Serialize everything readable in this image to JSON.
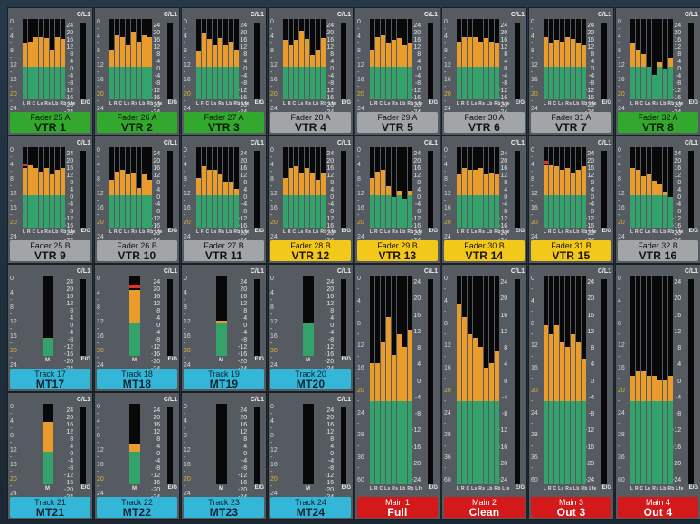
{
  "colors": {
    "green": "#33a82e",
    "gray": "#a1a5a8",
    "yellow": "#f2c81a",
    "cyan": "#33b6d8",
    "red": "#d4191b",
    "meter_green": "#34a36b",
    "meter_orange": "#e99b2c",
    "peak": "#e3312c"
  },
  "strips": [
    {
      "line1": "Fader 25 A",
      "line2": "VTR 1",
      "color": "green",
      "type": "multi",
      "levels": [
        0.7,
        0.72,
        0.78,
        0.78,
        0.76,
        0.62,
        0.78,
        0.75
      ]
    },
    {
      "line1": "Fader 26 A",
      "line2": "VTR 2",
      "color": "green",
      "type": "multi",
      "levels": [
        0.62,
        0.8,
        0.78,
        0.68,
        0.84,
        0.72,
        0.8,
        0.78
      ]
    },
    {
      "line1": "Fader 27 A",
      "line2": "VTR 3",
      "color": "green",
      "type": "multi",
      "levels": [
        0.6,
        0.82,
        0.75,
        0.68,
        0.76,
        0.68,
        0.72,
        0.62
      ]
    },
    {
      "line1": "Fader 28 A",
      "line2": "VTR 4",
      "color": "gray",
      "type": "multi",
      "levels": [
        0.74,
        0.68,
        0.74,
        0.85,
        0.75,
        0.55,
        0.62,
        0.76
      ]
    },
    {
      "line1": "Fader 29 A",
      "line2": "VTR 5",
      "color": "gray",
      "type": "multi",
      "levels": [
        0.62,
        0.78,
        0.8,
        0.7,
        0.74,
        0.76,
        0.68,
        0.7
      ]
    },
    {
      "line1": "Fader 30 A",
      "line2": "VTR 6",
      "color": "gray",
      "type": "multi",
      "levels": [
        0.72,
        0.78,
        0.78,
        0.78,
        0.72,
        0.76,
        0.72,
        0.7
      ]
    },
    {
      "line1": "Fader 31 A",
      "line2": "VTR 7",
      "color": "gray",
      "type": "multi",
      "levels": [
        0.78,
        0.7,
        0.74,
        0.72,
        0.78,
        0.75,
        0.7,
        0.68
      ]
    },
    {
      "line1": "Fader 32 A",
      "line2": "VTR 8",
      "color": "green",
      "type": "multi",
      "levels": [
        0.7,
        0.62,
        0.56,
        0.4,
        0.3,
        0.46,
        0.38,
        0.52
      ]
    },
    {
      "line1": "Fader 25 B",
      "line2": "VTR 9",
      "color": "gray",
      "type": "multi",
      "levels": [
        0.74,
        0.78,
        0.74,
        0.7,
        0.74,
        0.66,
        0.72,
        0.74
      ],
      "peak": 1
    },
    {
      "line1": "Fader 26 B",
      "line2": "VTR 10",
      "color": "gray",
      "type": "multi",
      "levels": [
        0.6,
        0.7,
        0.72,
        0.66,
        0.68,
        0.5,
        0.66,
        0.6
      ]
    },
    {
      "line1": "Fader 27 B",
      "line2": "VTR 11",
      "color": "gray",
      "type": "multi",
      "levels": [
        0.62,
        0.76,
        0.72,
        0.72,
        0.66,
        0.56,
        0.56,
        0.48
      ]
    },
    {
      "line1": "Fader 28 B",
      "line2": "VTR 12",
      "color": "yellow",
      "type": "multi",
      "levels": [
        0.62,
        0.74,
        0.76,
        0.68,
        0.74,
        0.68,
        0.6,
        0.68
      ]
    },
    {
      "line1": "Fader 29 B",
      "line2": "VTR 13",
      "color": "yellow",
      "type": "multi",
      "levels": [
        0.62,
        0.7,
        0.72,
        0.52,
        0.38,
        0.46,
        0.36,
        0.46
      ]
    },
    {
      "line1": "Fader 30 B",
      "line2": "VTR 14",
      "color": "yellow",
      "type": "multi",
      "levels": [
        0.66,
        0.74,
        0.72,
        0.72,
        0.74,
        0.66,
        0.68,
        0.66
      ]
    },
    {
      "line1": "Fader 31 B",
      "line2": "VTR 15",
      "color": "yellow",
      "type": "multi",
      "levels": [
        0.78,
        0.78,
        0.76,
        0.72,
        0.74,
        0.68,
        0.72,
        0.76
      ],
      "peak": 1
    },
    {
      "line1": "Fader 32 B",
      "line2": "VTR 16",
      "color": "gray",
      "type": "multi",
      "levels": [
        0.74,
        0.72,
        0.64,
        0.66,
        0.58,
        0.54,
        0.44,
        0.38
      ]
    },
    {
      "line1": "Track 17",
      "line2": "MT17",
      "color": "cyan",
      "type": "mono",
      "level": 0.22
    },
    {
      "line1": "Track 18",
      "line2": "MT18",
      "color": "cyan",
      "type": "mono",
      "level": 0.82,
      "peak": 1
    },
    {
      "line1": "Track 19",
      "line2": "MT19",
      "color": "cyan",
      "type": "mono",
      "level": 0.44
    },
    {
      "line1": "Track 20",
      "line2": "MT20",
      "color": "cyan",
      "type": "mono",
      "level": 0.4
    },
    {
      "line1": "Track 21",
      "line2": "MT21",
      "color": "cyan",
      "type": "mono",
      "level": 0.78
    },
    {
      "line1": "Track 22",
      "line2": "MT22",
      "color": "cyan",
      "type": "mono",
      "level": 0.5
    },
    {
      "line1": "Track 23",
      "line2": "MT23",
      "color": "cyan",
      "type": "mono",
      "level": 0.0
    },
    {
      "line1": "Track 24",
      "line2": "MT24",
      "color": "cyan",
      "type": "mono",
      "level": 0.0
    },
    {
      "line1": "Main 1",
      "line2": "Full",
      "color": "red",
      "type": "main",
      "levels": [
        0.58,
        0.58,
        0.68,
        0.8,
        0.62,
        0.72,
        0.66,
        0.74
      ]
    },
    {
      "line1": "Main 2",
      "line2": "Clean",
      "color": "red",
      "type": "main",
      "levels": [
        0.86,
        0.8,
        0.72,
        0.7,
        0.66,
        0.56,
        0.58,
        0.64
      ]
    },
    {
      "line1": "Main 3",
      "line2": "Out 3",
      "color": "red",
      "type": "main",
      "levels": [
        0.76,
        0.72,
        0.76,
        0.68,
        0.66,
        0.72,
        0.68,
        0.6
      ]
    },
    {
      "line1": "Main 4",
      "line2": "Out 4",
      "color": "red",
      "type": "main",
      "levels": [
        0.52,
        0.54,
        0.54,
        0.52,
        0.52,
        0.5,
        0.5,
        0.52
      ]
    }
  ],
  "scale_left": [
    "0",
    "-",
    "4",
    "-",
    "8",
    "-",
    "12",
    "-",
    "16",
    "-",
    "20",
    "-",
    "24",
    "-",
    "28",
    "-",
    "36",
    "-",
    "60"
  ],
  "scale_right": [
    "24",
    "20",
    "16",
    "12",
    "8",
    "4",
    "0",
    "-4",
    "-8",
    "-12",
    "-16",
    "-20",
    "-24"
  ],
  "c1_label": "C/L1",
  "eg_label": "E/G",
  "ch_labels": "L R C Ls Rs Lb Rb Lfe",
  "mono_ch_label": "M"
}
